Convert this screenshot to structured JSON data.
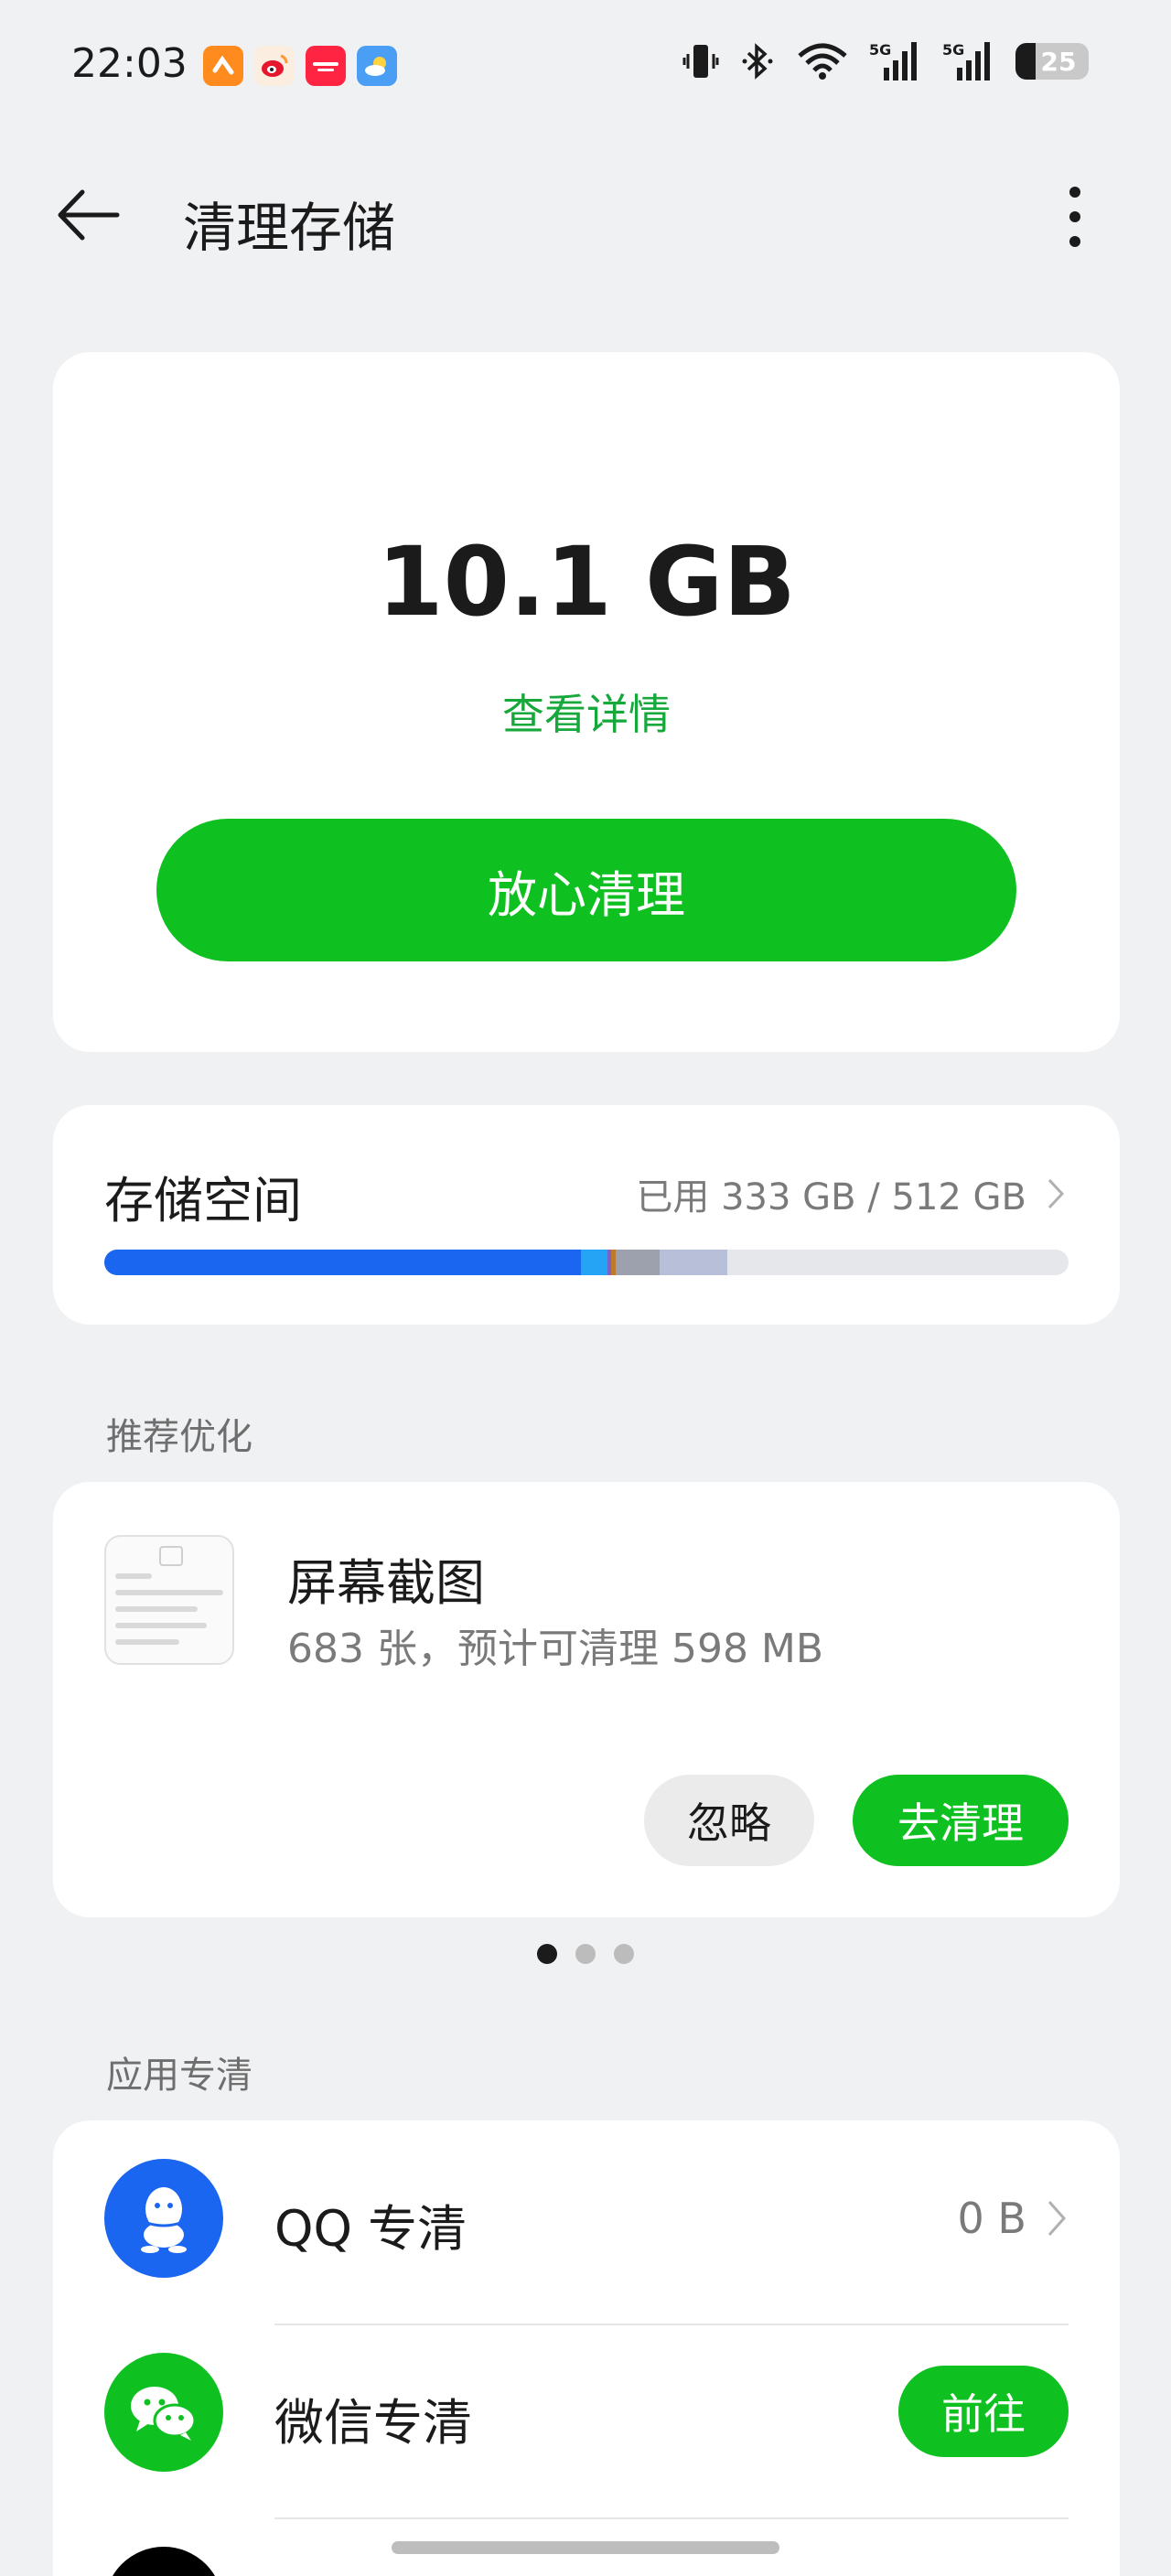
{
  "status_bar": {
    "time": "22:03",
    "battery": "25",
    "icons": [
      "vibrate-icon",
      "bluetooth-icon",
      "wifi-icon",
      "signal-5g-icon",
      "signal-5g-icon",
      "battery-icon"
    ],
    "notification_apps": [
      "app-icon-orange",
      "weibo-icon",
      "xiaohongshu-icon",
      "weather-icon"
    ]
  },
  "header": {
    "title": "清理存储"
  },
  "hero": {
    "size": "10.1 GB",
    "detail_link": "查看详情",
    "clean_button": "放心清理"
  },
  "storage": {
    "title": "存储空间",
    "used": "已用 333 GB / 512 GB",
    "segments": [
      {
        "color": "#1a66f0",
        "fraction": 0.494
      },
      {
        "color": "#25a4f5",
        "fraction": 0.028
      },
      {
        "color": "#7b62c9",
        "fraction": 0.004
      },
      {
        "color": "#c07a2e",
        "fraction": 0.004
      },
      {
        "color": "#9da1ad",
        "fraction": 0.046
      },
      {
        "color": "#b8bfd8",
        "fraction": 0.07
      }
    ]
  },
  "recommend": {
    "section_label": "推荐优化",
    "title": "屏幕截图",
    "desc": "683 张，预计可清理 598 MB",
    "ignore_button": "忽略",
    "clean_button": "去清理",
    "page_dots": 3,
    "active_dot": 0
  },
  "apps": {
    "section_label": "应用专清",
    "items": [
      {
        "name": "QQ 专清",
        "value": "0 B",
        "icon": "qq-icon",
        "color": "#1a66f0"
      },
      {
        "name": "微信专清",
        "action": "前往",
        "icon": "wechat-icon",
        "color": "#0ec121"
      }
    ]
  }
}
